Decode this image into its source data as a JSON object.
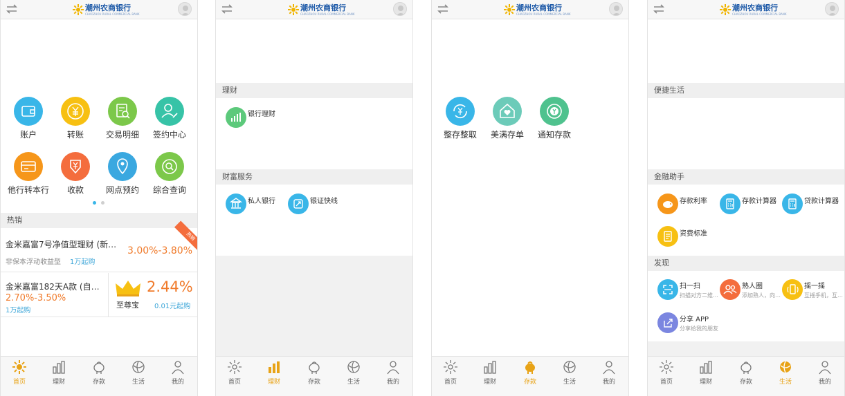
{
  "brand": {
    "name": "潮州农商银行",
    "sub": "CHAOZHOU RURAL COMMERCIAL BANK"
  },
  "screen1": {
    "grid": [
      {
        "label": "账户",
        "color": "#39b6e8",
        "icon": "wallet-icon"
      },
      {
        "label": "转账",
        "color": "#f7c012",
        "icon": "yen-circle-icon"
      },
      {
        "label": "交易明细",
        "color": "#7cc84a",
        "icon": "receipt-search-icon"
      },
      {
        "label": "签约中心",
        "color": "#37c3a7",
        "icon": "user-sign-icon"
      },
      {
        "label": "他行转本行",
        "color": "#f6961a",
        "icon": "card-transfer-icon"
      },
      {
        "label": "收款",
        "color": "#f46d3d",
        "icon": "yen-download-icon"
      },
      {
        "label": "网点预约",
        "color": "#3aa8e0",
        "icon": "location-pin-icon"
      },
      {
        "label": "综合查询",
        "color": "#7cc84a",
        "icon": "search-circle-icon"
      }
    ],
    "section_hot": "热销",
    "product1": {
      "title": "金米嘉富7号净值型理财 (新…",
      "type": "非保本浮动收益型",
      "min": "1万起购",
      "rate": "3.00%-3.80%",
      "badge": "热销"
    },
    "product2": {
      "title": "金米嘉富182天A款 (自…",
      "rate": "2.70%-3.50%",
      "min": "1万起购"
    },
    "product3": {
      "name": "至尊宝",
      "rate": "2.44%",
      "min": "0.01元起购"
    }
  },
  "screen2": {
    "section1": "理财",
    "item1": {
      "label": "银行理财",
      "color": "#5cc97b",
      "icon": "bar-chart-icon"
    },
    "section2": "财富服务",
    "item2": {
      "label": "私人银行",
      "color": "#39b6e8",
      "icon": "bank-building-icon"
    },
    "item3": {
      "label": "银证快线",
      "color": "#39b6e8",
      "icon": "exchange-icon"
    }
  },
  "screen3": {
    "items": [
      {
        "label": "整存整取",
        "color": "#39b6e8",
        "icon": "yen-refresh-icon"
      },
      {
        "label": "美满存单",
        "color": "#6ccbb9",
        "icon": "home-heart-icon"
      },
      {
        "label": "通知存款",
        "color": "#4fc28e",
        "icon": "yen-bell-icon"
      }
    ]
  },
  "screen4": {
    "section1": "便捷生活",
    "section2": "金融助手",
    "assist": [
      {
        "label": "存款利率",
        "color": "#f6961a",
        "icon": "piggy-bank-icon"
      },
      {
        "label": "存款计算器",
        "color": "#39b6e8",
        "icon": "calculator-icon"
      },
      {
        "label": "贷款计算器",
        "color": "#39b6e8",
        "icon": "calculator-icon"
      },
      {
        "label": "资费标准",
        "color": "#f7c012",
        "icon": "fee-list-icon"
      }
    ],
    "section3": "发现",
    "discover": [
      {
        "label": "扫一扫",
        "sub": "扫描对方二维…",
        "color": "#39b6e8",
        "icon": "scan-icon"
      },
      {
        "label": "熟人圈",
        "sub": "添加熟人，向…",
        "color": "#f46d3d",
        "icon": "friends-icon"
      },
      {
        "label": "摇一摇",
        "sub": "互摇手机，互…",
        "color": "#f7c012",
        "icon": "shake-phone-icon"
      },
      {
        "label": "分享 APP",
        "sub": "分享给我的朋友",
        "color": "#7b86e0",
        "icon": "share-icon"
      }
    ]
  },
  "tabs": [
    "首页",
    "理财",
    "存款",
    "生活",
    "我的"
  ],
  "colors": {
    "accent": "#e8a317",
    "orange": "#f07a2a",
    "blue": "#3da6d8"
  }
}
